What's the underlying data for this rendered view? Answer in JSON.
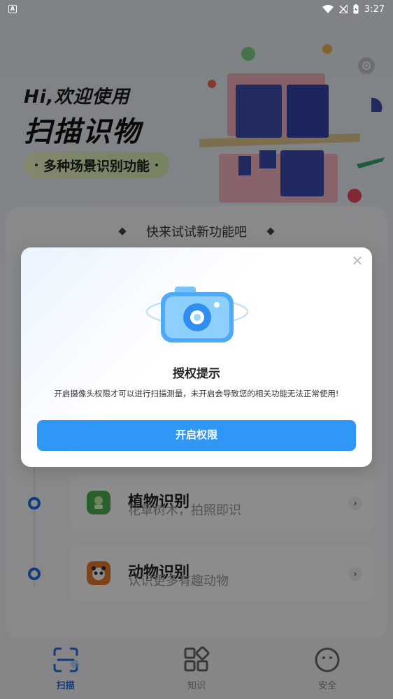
{
  "status_bar": {
    "time": "3:27",
    "left_icon": "a-notification-icon",
    "icons": [
      "wifi-icon",
      "signal-off-icon",
      "battery-charging-icon"
    ]
  },
  "hero": {
    "greeting": "Hi,欢迎使用",
    "title": "扫描识物",
    "pill_text": "多种场景识别功能",
    "settings_icon": "gear-icon"
  },
  "promo": {
    "text": "快来试试新功能吧"
  },
  "features": [
    {
      "title": "植物识别",
      "subtitle": "花草树木，拍照即识",
      "icon": "plant-icon",
      "icon_color": "#4caf50"
    },
    {
      "title": "动物识别",
      "subtitle": "认识更多有趣动物",
      "icon": "panda-icon",
      "icon_color": "#e87a2e"
    }
  ],
  "bottom_nav": {
    "items": [
      {
        "label": "扫描",
        "icon": "scan-icon",
        "active": true
      },
      {
        "label": "知识",
        "icon": "grid-icon",
        "active": false
      },
      {
        "label": "安全",
        "icon": "shield-face-icon",
        "active": false
      }
    ]
  },
  "dialog": {
    "title": "授权提示",
    "message": "开启摄像头权限才可以进行扫描测量，未开启会导致您的相关功能无法正常使用!",
    "button_label": "开启权限",
    "close_icon": "close-icon",
    "illustration": "camera-icon"
  },
  "colors": {
    "accent": "#2f97f6",
    "nav_active": "#1e6fe0",
    "overlay": "rgba(0,0,0,0.45)"
  }
}
